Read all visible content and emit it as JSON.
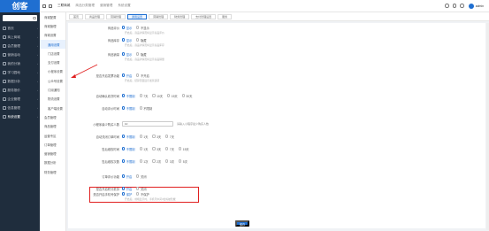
{
  "app": {
    "logo": "创客"
  },
  "topbar": {
    "items": [
      "三联商城",
      "商品分类管理",
      "营销管理",
      "系统设置"
    ],
    "username": "admin"
  },
  "sidebar": {
    "items": [
      {
        "label": "首页",
        "icon": "home-icon"
      },
      {
        "label": "商上商城",
        "icon": "shop-icon"
      },
      {
        "label": "会员管理",
        "icon": "user-icon"
      },
      {
        "label": "营销活动",
        "icon": "chart-icon"
      },
      {
        "label": "我的分销",
        "icon": "share-icon"
      },
      {
        "label": "学习园地",
        "icon": "book-icon"
      },
      {
        "label": "数据分析",
        "icon": "data-icon"
      },
      {
        "label": "服务报价",
        "icon": "price-icon"
      },
      {
        "label": "企业管理",
        "icon": "building-icon"
      },
      {
        "label": "信息管理",
        "icon": "message-icon"
      },
      {
        "label": "系统设置",
        "icon": "gear-icon"
      }
    ]
  },
  "subnav": {
    "items": [
      {
        "label": "商城配置",
        "child": false,
        "active": false
      },
      {
        "label": "商城管理",
        "child": false,
        "active": false
      },
      {
        "label": "商城设置",
        "child": false,
        "active": false
      },
      {
        "label": "通用设置",
        "child": true,
        "active": true
      },
      {
        "label": "门店设置",
        "child": true,
        "active": false
      },
      {
        "label": "支付设置",
        "child": true,
        "active": false
      },
      {
        "label": "小程序设置",
        "child": true,
        "active": false
      },
      {
        "label": "公众号设置",
        "child": true,
        "active": false
      },
      {
        "label": "订阅通知",
        "child": true,
        "active": false
      },
      {
        "label": "物流设置",
        "child": true,
        "active": false
      },
      {
        "label": "客户端设置",
        "child": true,
        "active": false
      },
      {
        "label": "会员管理",
        "child": false,
        "active": false
      },
      {
        "label": "商品管理",
        "child": false,
        "active": false
      },
      {
        "label": "运营专区",
        "child": false,
        "active": false
      },
      {
        "label": "订单管理",
        "child": false,
        "active": false
      },
      {
        "label": "营销管理",
        "child": false,
        "active": false
      },
      {
        "label": "数据分析",
        "child": false,
        "active": false
      },
      {
        "label": "财务管理",
        "child": false,
        "active": false
      }
    ]
  },
  "tabs": [
    {
      "label": "首页",
      "active": false
    },
    {
      "label": "商品管理",
      "active": false
    },
    {
      "label": "营销管理",
      "active": false
    },
    {
      "label": "通用设置",
      "active": true
    },
    {
      "label": "营销管理",
      "active": false
    },
    {
      "label": "财务管理",
      "active": false
    },
    {
      "label": "支付管理设置",
      "active": false
    },
    {
      "label": "服务",
      "active": false
    }
  ],
  "form": {
    "rows": [
      {
        "label": "商品评价",
        "options": [
          "显示",
          "不显示"
        ],
        "selected": 0,
        "hint": "开启后，商品详情页将显示商品评价"
      },
      {
        "label": "商品库存",
        "options": [
          "显示",
          "隐藏"
        ],
        "selected": 0,
        "hint": "开启后，商品详情页将显示商品库存"
      },
      {
        "label": "商品销量",
        "options": [
          "显示",
          "隐藏"
        ],
        "selected": 0,
        "hint": "开启后，商品详情页将显示商品销量"
      },
      {
        "label": "是否开启发票功能",
        "options": [
          "开启",
          "不开启"
        ],
        "selected": 0,
        "hint": "开启后，结算页面显示发票选项"
      },
      {
        "label": "自动确认收货时间",
        "options": [
          "不限制",
          "7天",
          "10天",
          "15天",
          "30天"
        ],
        "selected": 0
      },
      {
        "label": "自动评价时间",
        "options": [
          "不限制",
          "不限制"
        ],
        "selected": 0
      },
      {
        "label": "自动关闭订单时间",
        "options": [
          "不限制",
          "1天",
          "3天",
          "7天"
        ],
        "selected": 0
      },
      {
        "label": "售后维权时间",
        "options": [
          "不限制",
          "1天",
          "3天",
          "7天",
          "15天"
        ],
        "selected": 0
      },
      {
        "label": "售后维权次数",
        "options": [
          "不限制",
          "1次",
          "2次",
          "3次",
          "5次"
        ],
        "selected": 0
      },
      {
        "label": "订单评价功能",
        "options": [
          "开启",
          "关闭"
        ],
        "selected": 0
      },
      {
        "label": "是否开启积分抵扣",
        "options": [
          "开启",
          "关闭"
        ],
        "selected": 0
      },
      {
        "label": "是否开启手机号保护",
        "options": [
          "保护",
          "不保护"
        ],
        "selected": 0,
        "hint": "开启后，前端显示时，手机号中间4位将被隐藏"
      }
    ],
    "number_row": {
      "label": "小程序最少购买人数",
      "value": "10",
      "hint": "请输入小程序最少购买人数"
    }
  },
  "actions": {
    "save": "保存"
  }
}
